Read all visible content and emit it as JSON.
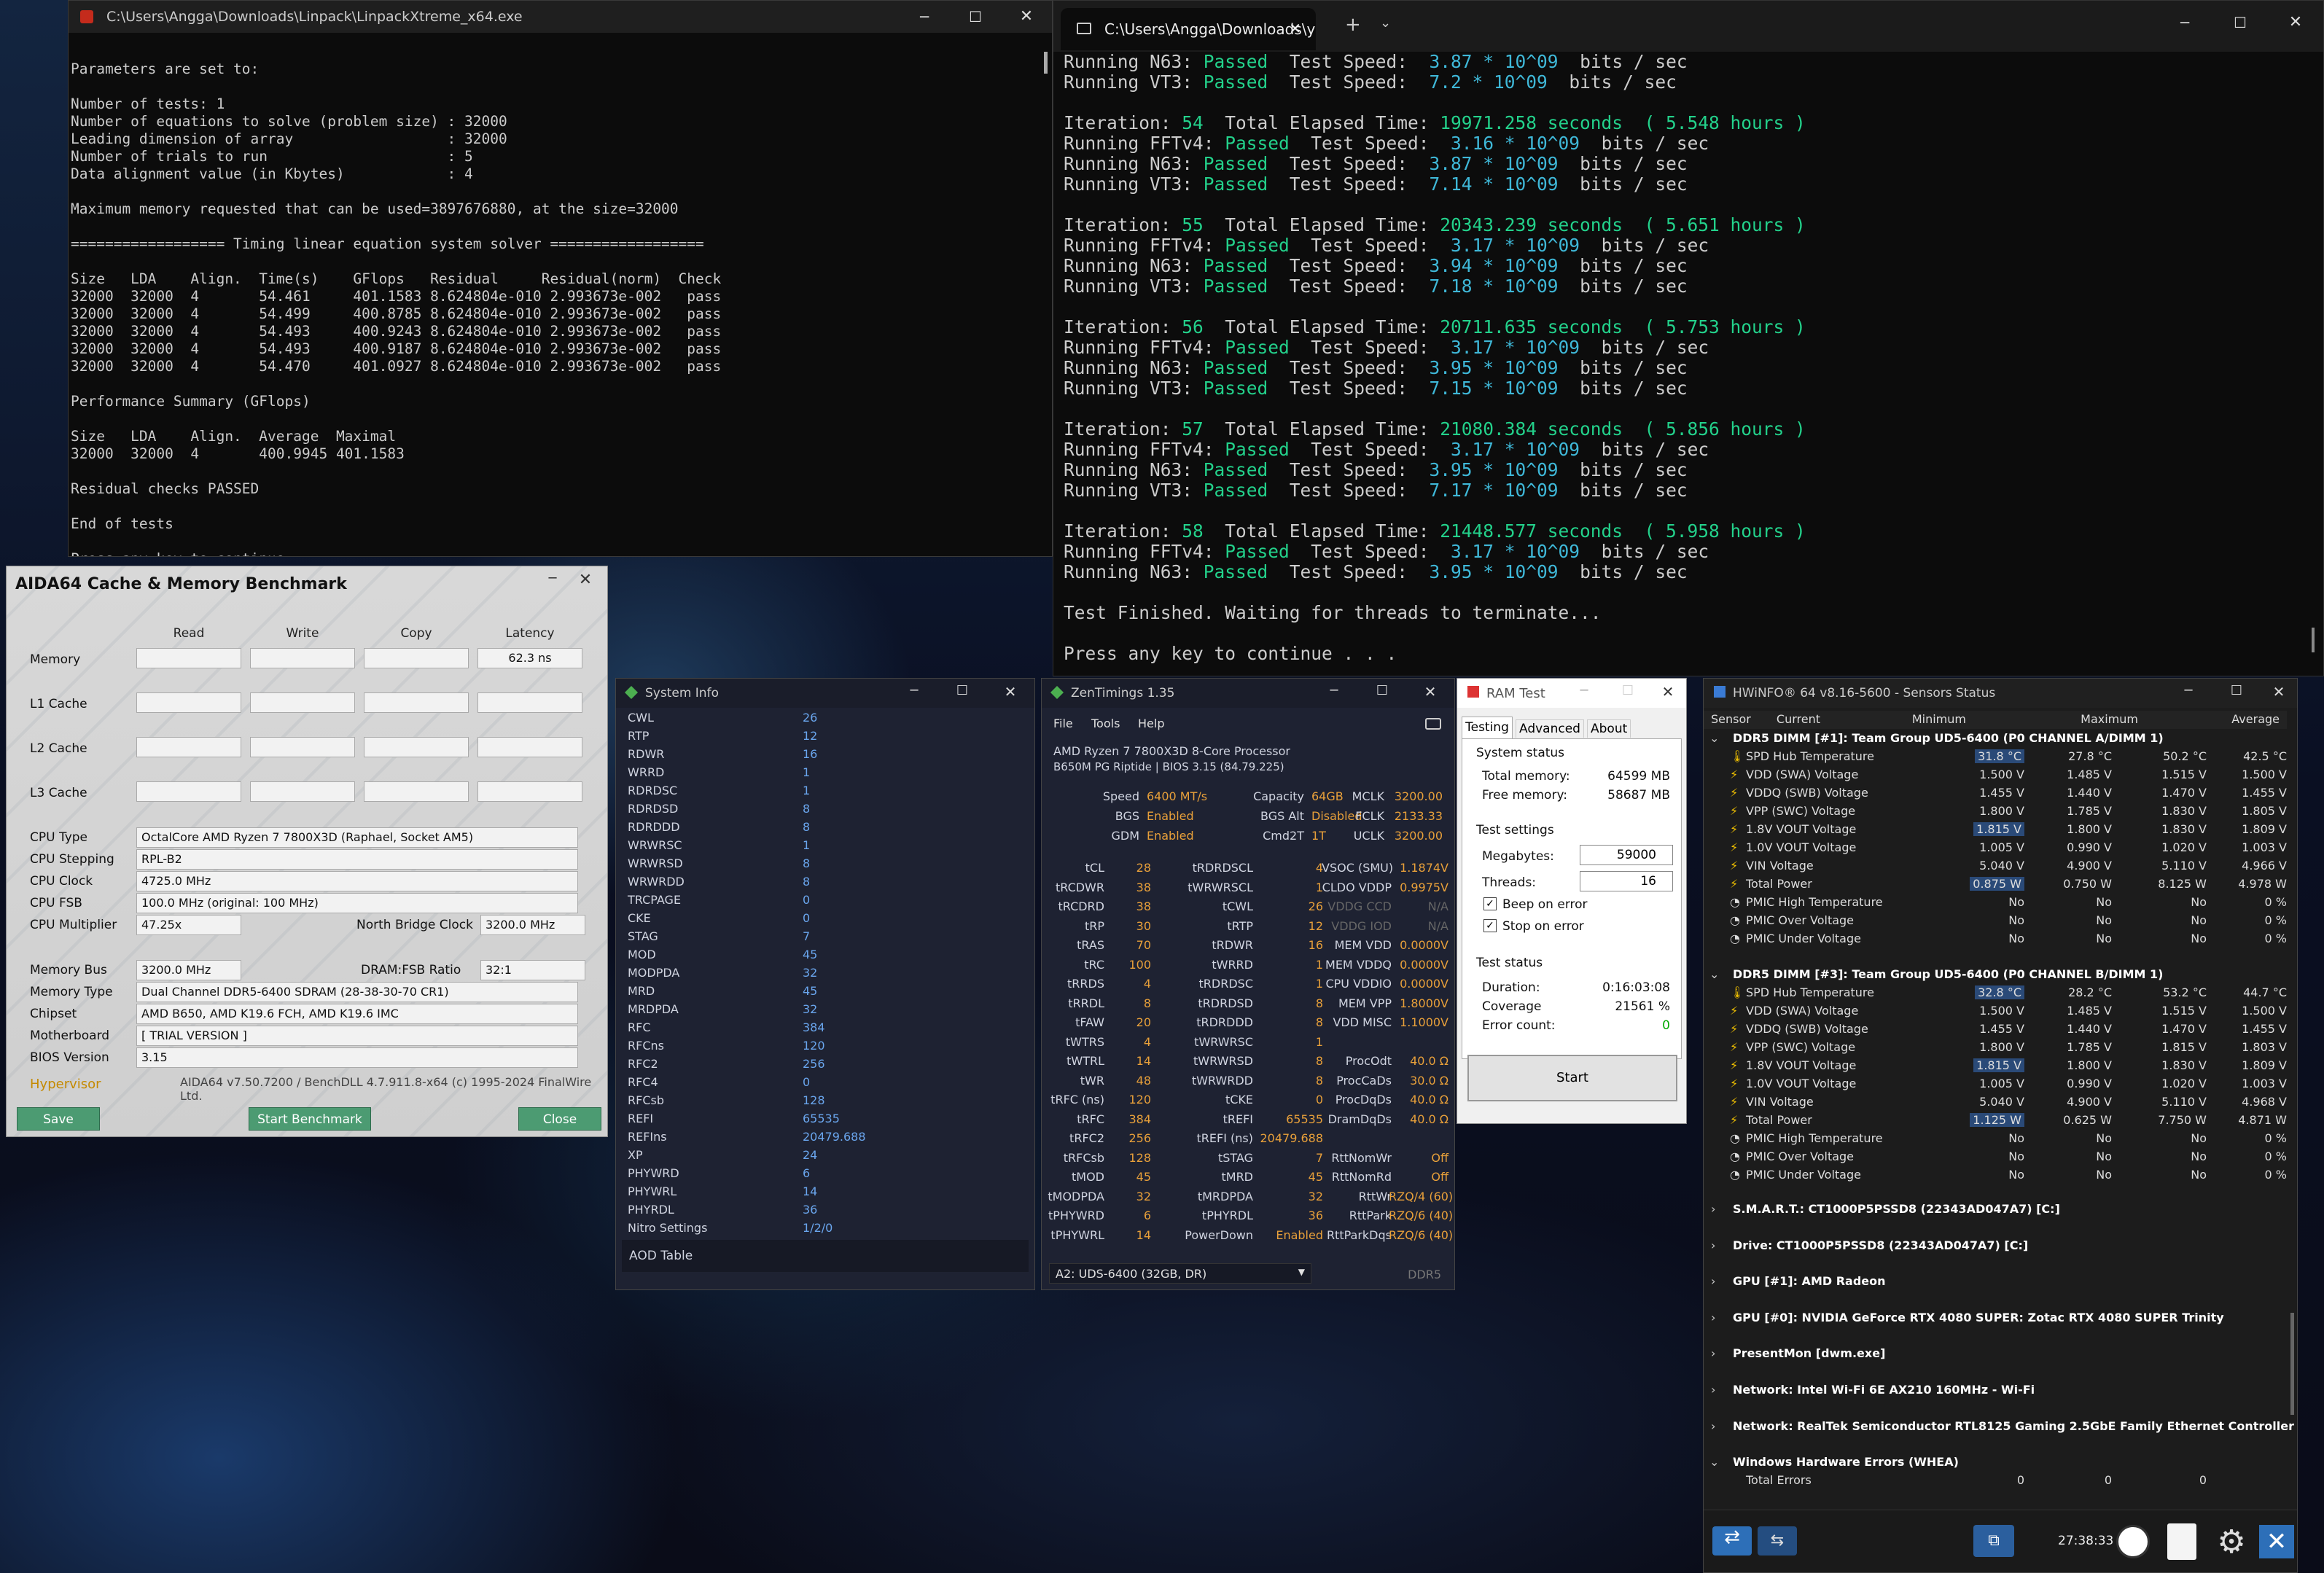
{
  "cmd1": {
    "title": "C:\\Users\\Angga\\Downloads\\Linpack\\LinpackXtreme_x64.exe",
    "lines": [
      "",
      "Parameters are set to:",
      "",
      "Number of tests: 1",
      "Number of equations to solve (problem size) : 32000",
      "Leading dimension of array                  : 32000",
      "Number of trials to run                     : 5",
      "Data alignment value (in Kbytes)            : 4",
      "",
      "Maximum memory requested that can be used=3897676880, at the size=32000",
      "",
      "================== Timing linear equation system solver ==================",
      "",
      "Size   LDA    Align.  Time(s)    GFlops   Residual     Residual(norm)  Check",
      "32000  32000  4       54.461     401.1583 8.624804e-010 2.993673e-002   pass",
      "32000  32000  4       54.499     400.8785 8.624804e-010 2.993673e-002   pass",
      "32000  32000  4       54.493     400.9243 8.624804e-010 2.993673e-002   pass",
      "32000  32000  4       54.493     400.9187 8.624804e-010 2.993673e-002   pass",
      "32000  32000  4       54.470     401.0927 8.624804e-010 2.993673e-002   pass",
      "",
      "Performance Summary (GFlops)",
      "",
      "Size   LDA    Align.  Average  Maximal",
      "32000  32000  4       400.9945 401.1583",
      "",
      "Residual checks PASSED",
      "",
      "End of tests",
      "",
      "Press any key to continue . . ."
    ]
  },
  "cmd2": {
    "tab": "C:\\Users\\Angga\\Downloads\\y",
    "iterations": [
      {
        "n": "54",
        "elapsed": "19971.258 seconds",
        "hours": "( 5.548 hours )",
        "fft": "3.16",
        "n63": "3.87",
        "vt3": "7.14"
      },
      {
        "n": "55",
        "elapsed": "20343.239 seconds",
        "hours": "( 5.651 hours )",
        "fft": "3.17",
        "n63": "3.94",
        "vt3": "7.18"
      },
      {
        "n": "56",
        "elapsed": "20711.635 seconds",
        "hours": "( 5.753 hours )",
        "fft": "3.17",
        "n63": "3.95",
        "vt3": "7.15"
      },
      {
        "n": "57",
        "elapsed": "21080.384 seconds",
        "hours": "( 5.856 hours )",
        "fft": "3.17",
        "n63": "3.95",
        "vt3": "7.17"
      },
      {
        "n": "58",
        "elapsed": "21448.577 seconds",
        "hours": "( 5.958 hours )",
        "fft": "3.17",
        "n63": "3.95",
        "vt3": ""
      }
    ],
    "top_n63": "3.87",
    "top_vt3": "7.2",
    "finished": "Test Finished. Waiting for threads to terminate...",
    "press": "Press any key to continue . . ."
  },
  "aida": {
    "title": "AIDA64 Cache & Memory Benchmark",
    "cols": [
      "Read",
      "Write",
      "Copy",
      "Latency"
    ],
    "rows": [
      "Memory",
      "L1 Cache",
      "L2 Cache",
      "L3 Cache"
    ],
    "latency": "62.3 ns",
    "info": [
      [
        "CPU Type",
        "OctalCore AMD Ryzen 7 7800X3D  (Raphael, Socket AM5)"
      ],
      [
        "CPU Stepping",
        "RPL-B2"
      ],
      [
        "CPU Clock",
        "4725.0 MHz"
      ],
      [
        "CPU FSB",
        "100.0 MHz  (original: 100 MHz)"
      ],
      [
        "CPU Multiplier",
        "47.25x"
      ]
    ],
    "nb_label": "North Bridge Clock",
    "nb": "3200.0 MHz",
    "info2": [
      [
        "Memory Bus",
        "3200.0 MHz"
      ],
      [
        "Memory Type",
        "Dual Channel DDR5-6400 SDRAM  (28-38-30-70 CR1)"
      ],
      [
        "Chipset",
        "AMD B650, AMD K19.6 FCH, AMD K19.6 IMC"
      ],
      [
        "Motherboard",
        "[ TRIAL VERSION ]"
      ],
      [
        "BIOS Version",
        "3.15"
      ]
    ],
    "ratio_label": "DRAM:FSB Ratio",
    "ratio": "32:1",
    "hypervisor": "Hypervisor",
    "footer": "AIDA64 v7.50.7200 / BenchDLL 4.7.911.8-x64  (c) 1995-2024 FinalWire Ltd.",
    "save": "Save",
    "start": "Start Benchmark",
    "close": "Close"
  },
  "sys": {
    "title": "System Info",
    "rows": [
      [
        "CWL",
        "26"
      ],
      [
        "RTP",
        "12"
      ],
      [
        "RDWR",
        "16"
      ],
      [
        "WRRD",
        "1"
      ],
      [
        "RDRDSC",
        "1"
      ],
      [
        "RDRDSD",
        "8"
      ],
      [
        "RDRDDD",
        "8"
      ],
      [
        "WRWRSC",
        "1"
      ],
      [
        "WRWRSD",
        "8"
      ],
      [
        "WRWRDD",
        "8"
      ],
      [
        "TRCPAGE",
        "0"
      ],
      [
        "CKE",
        "0"
      ],
      [
        "STAG",
        "7"
      ],
      [
        "MOD",
        "45"
      ],
      [
        "MODPDA",
        "32"
      ],
      [
        "MRD",
        "45"
      ],
      [
        "MRDPDA",
        "32"
      ],
      [
        "RFC",
        "384"
      ],
      [
        "RFCns",
        "120"
      ],
      [
        "RFC2",
        "256"
      ],
      [
        "RFC4",
        "0"
      ],
      [
        "RFCsb",
        "128"
      ],
      [
        "REFI",
        "65535"
      ],
      [
        "REFIns",
        "20479.688"
      ],
      [
        "XP",
        "24"
      ],
      [
        "PHYWRD",
        "6"
      ],
      [
        "PHYWRL",
        "14"
      ],
      [
        "PHYRDL",
        "36"
      ],
      [
        "Nitro Settings",
        "1/2/0"
      ]
    ],
    "aod": "AOD Table"
  },
  "zen": {
    "title": "ZenTimings 1.35",
    "menu": [
      "File",
      "Tools",
      "Help"
    ],
    "cpu": "AMD Ryzen 7 7800X3D 8-Core Processor",
    "board": "B650M PG Riptide | BIOS 3.15 (84.79.225)",
    "top": [
      [
        "Speed",
        "6400 MT/s",
        "Capacity",
        "64GB",
        "MCLK",
        "3200.00"
      ],
      [
        "BGS",
        "Enabled",
        "BGS Alt",
        "Disabled",
        "FCLK",
        "2133.33"
      ],
      [
        "GDM",
        "Enabled",
        "Cmd2T",
        "1T",
        "UCLK",
        "3200.00"
      ]
    ],
    "rows": [
      [
        "tCL",
        "28",
        "tRDRDSCL",
        "4",
        "VSOC (SMU)",
        "1.1874V"
      ],
      [
        "tRCDWR",
        "38",
        "tWRWRSCL",
        "1",
        "CLDO VDDP",
        "0.9975V"
      ],
      [
        "tRCDRD",
        "38",
        "tCWL",
        "26",
        "VDDG CCD",
        "N/A"
      ],
      [
        "tRP",
        "30",
        "tRTP",
        "12",
        "VDDG IOD",
        "N/A"
      ],
      [
        "tRAS",
        "70",
        "tRDWR",
        "16",
        "MEM VDD",
        "0.0000V"
      ],
      [
        "tRC",
        "100",
        "tWRRD",
        "1",
        "MEM VDDQ",
        "0.0000V"
      ],
      [
        "tRRDS",
        "4",
        "tRDRDSC",
        "1",
        "CPU VDDIO",
        "0.0000V"
      ],
      [
        "tRRDL",
        "8",
        "tRDRDSD",
        "8",
        "MEM VPP",
        "1.8000V"
      ],
      [
        "tFAW",
        "20",
        "tRDRDDD",
        "8",
        "VDD MISC",
        "1.1000V"
      ],
      [
        "tWTRS",
        "4",
        "tWRWRSC",
        "1",
        "",
        ""
      ],
      [
        "tWTRL",
        "14",
        "tWRWRSD",
        "8",
        "ProcOdt",
        "40.0 Ω"
      ],
      [
        "tWR",
        "48",
        "tWRWRDD",
        "8",
        "ProcCaDs",
        "30.0 Ω"
      ],
      [
        "tRFC (ns)",
        "120",
        "tCKE",
        "0",
        "ProcDqDs",
        "40.0 Ω"
      ],
      [
        "tRFC",
        "384",
        "tREFI",
        "65535",
        "DramDqDs",
        "40.0 Ω"
      ],
      [
        "tRFC2",
        "256",
        "tREFI (ns)",
        "20479.688",
        "",
        ""
      ],
      [
        "tRFCsb",
        "128",
        "tSTAG",
        "7",
        "RttNomWr",
        "Off"
      ],
      [
        "tMOD",
        "45",
        "tMRD",
        "45",
        "RttNomRd",
        "Off"
      ],
      [
        "tMODPDA",
        "32",
        "tMRDPDA",
        "32",
        "RttWr",
        "RZQ/4 (60)"
      ],
      [
        "tPHYWRD",
        "6",
        "tPHYRDL",
        "36",
        "RttPark",
        "RZQ/6 (40)"
      ],
      [
        "tPHYWRL",
        "14",
        "PowerDown",
        "Enabled",
        "RttParkDqs",
        "RZQ/6 (40)"
      ]
    ],
    "dimm": "A2: UDS-6400 (32GB, DR)",
    "ddr": "DDR5"
  },
  "ram": {
    "title": "RAM Test",
    "tabs": [
      "Testing",
      "Advanced",
      "About"
    ],
    "status": "System status",
    "total_l": "Total memory:",
    "total": "64599 MB",
    "free_l": "Free memory:",
    "free": "58687 MB",
    "settings": "Test settings",
    "mb_l": "Megabytes:",
    "mb": "59000",
    "th_l": "Threads:",
    "th": "16",
    "beep": "Beep on error",
    "stop": "Stop on error",
    "tstatus": "Test status",
    "dur_l": "Duration:",
    "dur": "0:16:03:08",
    "cov_l": "Coverage",
    "cov": "21561 %",
    "err_l": "Error count:",
    "err": "0",
    "start": "Start"
  },
  "hw": {
    "title": "HWiNFO® 64 v8.16-5600 - Sensors Status",
    "cols": [
      "Sensor",
      "Current",
      "Minimum",
      "Maximum",
      "Average"
    ],
    "groups": [
      {
        "name": "DDR5 DIMM [#1]: Team Group UD5-6400 (P0 CHANNEL A/DIMM 1)",
        "rows": [
          [
            "SPD Hub Temperature",
            "31.8 °C",
            "27.8 °C",
            "50.2 °C",
            "42.5 °C"
          ],
          [
            "VDD (SWA) Voltage",
            "1.500 V",
            "1.485 V",
            "1.515 V",
            "1.500 V"
          ],
          [
            "VDDQ (SWB) Voltage",
            "1.455 V",
            "1.440 V",
            "1.470 V",
            "1.455 V"
          ],
          [
            "VPP (SWC) Voltage",
            "1.800 V",
            "1.785 V",
            "1.830 V",
            "1.805 V"
          ],
          [
            "1.8V VOUT Voltage",
            "1.815 V",
            "1.800 V",
            "1.830 V",
            "1.809 V"
          ],
          [
            "1.0V VOUT Voltage",
            "1.005 V",
            "0.990 V",
            "1.020 V",
            "1.003 V"
          ],
          [
            "VIN Voltage",
            "5.040 V",
            "4.900 V",
            "5.110 V",
            "4.966 V"
          ],
          [
            "Total Power",
            "0.875 W",
            "0.750 W",
            "8.125 W",
            "4.978 W"
          ],
          [
            "PMIC High Temperature",
            "No",
            "No",
            "No",
            "0 %"
          ],
          [
            "PMIC Over Voltage",
            "No",
            "No",
            "No",
            "0 %"
          ],
          [
            "PMIC Under Voltage",
            "No",
            "No",
            "No",
            "0 %"
          ]
        ]
      },
      {
        "name": "DDR5 DIMM [#3]: Team Group UD5-6400 (P0 CHANNEL B/DIMM 1)",
        "rows": [
          [
            "SPD Hub Temperature",
            "32.8 °C",
            "28.2 °C",
            "53.2 °C",
            "44.7 °C"
          ],
          [
            "VDD (SWA) Voltage",
            "1.500 V",
            "1.485 V",
            "1.515 V",
            "1.500 V"
          ],
          [
            "VDDQ (SWB) Voltage",
            "1.455 V",
            "1.440 V",
            "1.470 V",
            "1.455 V"
          ],
          [
            "VPP (SWC) Voltage",
            "1.800 V",
            "1.785 V",
            "1.815 V",
            "1.803 V"
          ],
          [
            "1.8V VOUT Voltage",
            "1.815 V",
            "1.800 V",
            "1.830 V",
            "1.809 V"
          ],
          [
            "1.0V VOUT Voltage",
            "1.005 V",
            "0.990 V",
            "1.020 V",
            "1.003 V"
          ],
          [
            "VIN Voltage",
            "5.040 V",
            "4.900 V",
            "5.110 V",
            "4.968 V"
          ],
          [
            "Total Power",
            "1.125 W",
            "0.625 W",
            "7.750 W",
            "4.871 W"
          ],
          [
            "PMIC High Temperature",
            "No",
            "No",
            "No",
            "0 %"
          ],
          [
            "PMIC Over Voltage",
            "No",
            "No",
            "No",
            "0 %"
          ],
          [
            "PMIC Under Voltage",
            "No",
            "No",
            "No",
            "0 %"
          ]
        ]
      }
    ],
    "collapsed": [
      "S.M.A.R.T.: CT1000P5PSSD8 (22343AD047A7) [C:]",
      "Drive: CT1000P5PSSD8 (22343AD047A7) [C:]",
      "GPU [#1]: AMD Radeon",
      "GPU [#0]: NVIDIA GeForce RTX 4080 SUPER: Zotac RTX 4080 SUPER Trinity",
      "PresentMon [dwm.exe]",
      "Network: Intel Wi-Fi 6E AX210 160MHz - Wi-Fi",
      "Network: RealTek Semiconductor RTL8125 Gaming 2.5GbE Family Ethernet Controller - E..."
    ],
    "whea": "Windows Hardware Errors (WHEA)",
    "whea_row": [
      "Total Errors",
      "0",
      "0",
      "0"
    ],
    "time": "27:38:33"
  }
}
